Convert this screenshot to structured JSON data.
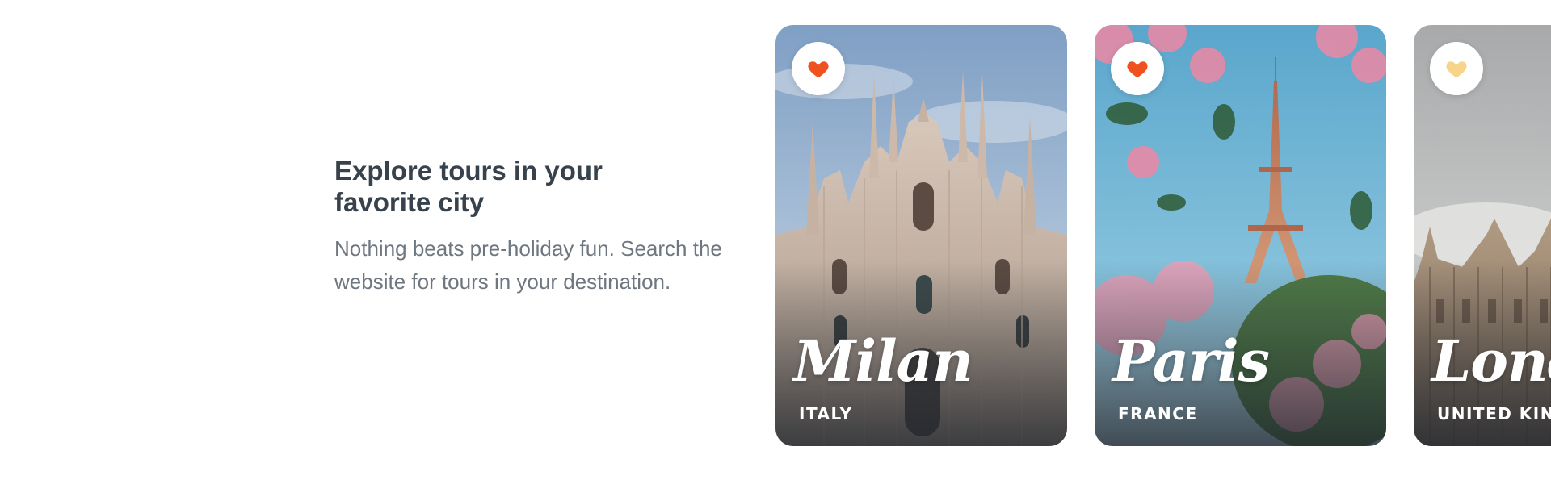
{
  "intro": {
    "title": "Explore tours in your favorite city",
    "description": "Nothing beats pre-holiday fun. Search the website for tours in your destination."
  },
  "colors": {
    "heading": "#37424c",
    "body_text": "#6e7680",
    "heart_active": "#f0521f",
    "heart_inactive": "#f8d48a"
  },
  "cards": [
    {
      "city": "Milan",
      "country": "ITALY",
      "favorite_icon": "heart-icon",
      "favorited": true
    },
    {
      "city": "Paris",
      "country": "FRANCE",
      "favorite_icon": "heart-icon",
      "favorited": true
    },
    {
      "city": "London",
      "country": "UNITED KINGDOM",
      "favorite_icon": "heart-icon",
      "favorited": false
    }
  ]
}
